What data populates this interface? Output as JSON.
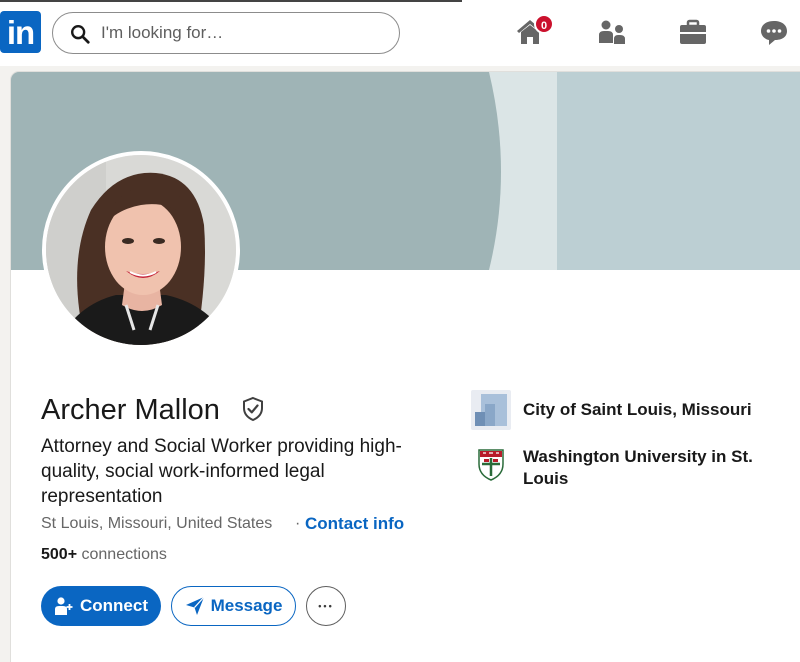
{
  "nav": {
    "logo_text": "in",
    "search_placeholder": "I'm looking for…",
    "home_badge": "0",
    "icons": [
      "linkedin-logo",
      "search-icon",
      "home-icon",
      "my-network-icon",
      "jobs-icon",
      "messaging-icon"
    ]
  },
  "profile": {
    "name": "Archer Mallon",
    "headline": "Attorney and Social Worker providing high-quality, social work-informed legal representation",
    "location": "St Louis, Missouri, United States",
    "separator": "·",
    "contact_label": "Contact info",
    "connections_count": "500+",
    "connections_label": "connections"
  },
  "actions": {
    "connect_label": "Connect",
    "message_label": "Message",
    "more_label": "•••"
  },
  "sidebar": {
    "orgs": [
      {
        "name": "City of Saint Louis, Missouri",
        "icon": "city-logo"
      },
      {
        "name": "Washington University in St. Louis",
        "icon": "university-shield-logo"
      }
    ]
  },
  "colors": {
    "brand": "#0a66c2",
    "banner_left": "#9fb4b6",
    "banner_stripe": "#dbe5e6",
    "banner_right": "#bccfd3",
    "badge": "#cb112d"
  }
}
